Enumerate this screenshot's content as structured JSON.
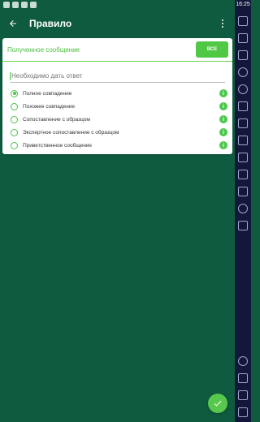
{
  "status": {
    "time": "16:25",
    "icons": [
      "mail-icon",
      "android-icon",
      "android-icon",
      "shield-icon"
    ]
  },
  "toolbar": {
    "title": "Правило"
  },
  "card": {
    "received_label": "Полученное сообщение",
    "all_button": "все",
    "answer_placeholder": "Необходимо дать ответ",
    "options": [
      {
        "label": "Полное совпадение",
        "selected": true
      },
      {
        "label": "Похожее совпадение",
        "selected": false
      },
      {
        "label": "Сопоставление с образцом",
        "selected": false
      },
      {
        "label": "Экспертное сопоставление с образцом",
        "selected": false
      },
      {
        "label": "Приветственное сообщение",
        "selected": false
      }
    ]
  },
  "colors": {
    "primary": "#0f5b3f",
    "accent": "#51c845",
    "sidebar": "#13183b"
  },
  "side_icons": [
    "volume-icon",
    "tv-icon",
    "mute-icon",
    "play-icon",
    "record-icon",
    "robot-icon",
    "apk-icon",
    "crop-icon",
    "folder-icon",
    "copy-icon",
    "pencil-icon",
    "location-icon",
    "layers-icon",
    "settings-icon",
    "back-icon",
    "home-icon",
    "recent-icon"
  ]
}
